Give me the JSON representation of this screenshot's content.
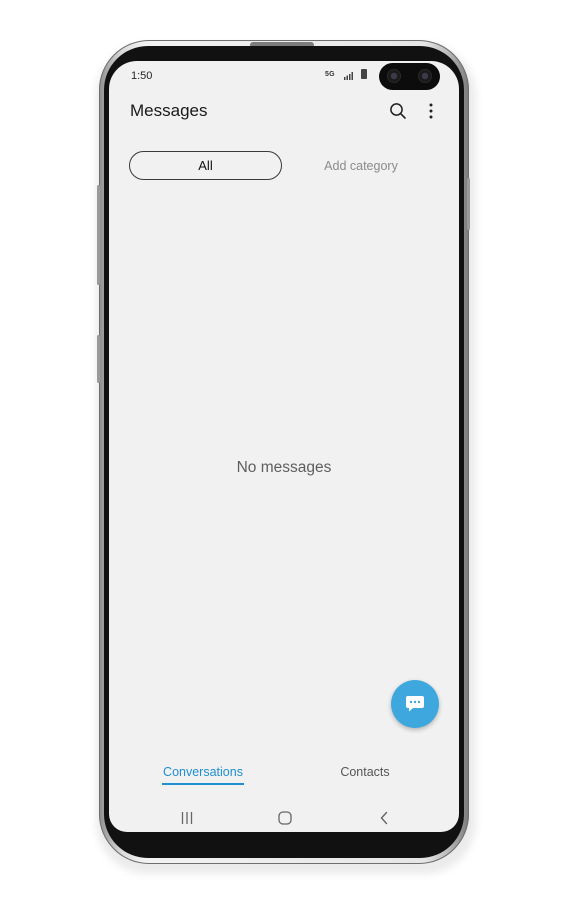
{
  "status_bar": {
    "time": "1:50",
    "network": "5G"
  },
  "header": {
    "title": "Messages",
    "search_icon": "search-icon",
    "more_icon": "more-vertical-icon"
  },
  "categories": {
    "selected": "All",
    "add_label": "Add category"
  },
  "main": {
    "empty_text": "No messages"
  },
  "fab": {
    "icon": "new-chat-icon",
    "color": "#3ea7de"
  },
  "bottom_tabs": [
    {
      "label": "Conversations",
      "active": true
    },
    {
      "label": "Contacts",
      "active": false
    }
  ],
  "nav_bar": {
    "recents_icon": "recents-icon",
    "home_icon": "home-icon",
    "back_icon": "back-icon"
  },
  "colors": {
    "accent": "#1f8fcf",
    "screen_bg": "#f1f1f1"
  }
}
